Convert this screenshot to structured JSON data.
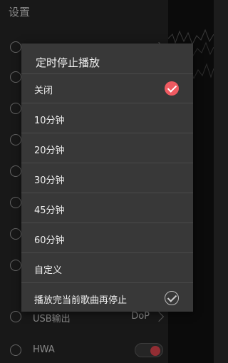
{
  "settings_screen": {
    "title": "设置",
    "rows": [
      {
        "label": "",
        "value": ""
      },
      {
        "label": "",
        "value": ""
      },
      {
        "label": "",
        "value": ""
      },
      {
        "label": "",
        "value": ""
      },
      {
        "label": "",
        "value": ""
      },
      {
        "label": "",
        "value": ""
      },
      {
        "label": "",
        "value": ""
      },
      {
        "label": "",
        "value": ""
      },
      {
        "label": "USB输出",
        "value": "DoP"
      },
      {
        "label": "HWA",
        "value": ""
      }
    ],
    "hwa_toggle_on": true,
    "accent_color": "#e0464f"
  },
  "sleep_timer_dialog": {
    "title": "定时停止播放",
    "selected_index": 0,
    "check_color": "#ef5a61",
    "options": [
      {
        "label": "关闭"
      },
      {
        "label": "10分钟"
      },
      {
        "label": "20分钟"
      },
      {
        "label": "30分钟"
      },
      {
        "label": "45分钟"
      },
      {
        "label": "60分钟"
      },
      {
        "label": "自定义"
      },
      {
        "label": "播放完当前歌曲再停止",
        "checkbox": true,
        "checked": false
      }
    ]
  }
}
